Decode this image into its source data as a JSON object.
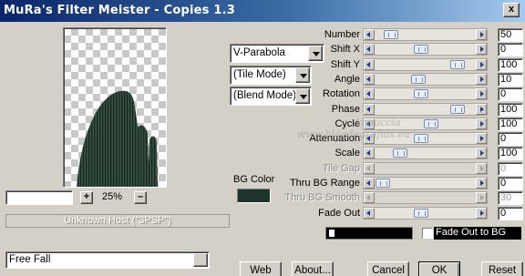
{
  "window": {
    "title": "MuRa's Filter Meister - Copies 1.3",
    "close_glyph": "x"
  },
  "preview": {
    "zoom_percent": "25%",
    "zoom_plus": "+",
    "zoom_minus": "–",
    "zoom_field_value": ""
  },
  "host_status": "Unknown Host (\"3PSP\")",
  "combos": {
    "shape": "V-Parabola",
    "tile_mode": "(Tile Mode)",
    "blend_mode": "(Blend Mode)"
  },
  "bg_color": {
    "label": "BG Color",
    "color": "#1e3329"
  },
  "params": [
    {
      "label": "Number",
      "value": "50",
      "pos": 0.1,
      "enabled": true
    },
    {
      "label": "Shift X",
      "value": "0",
      "pos": 0.45,
      "enabled": true
    },
    {
      "label": "Shift Y",
      "value": "100",
      "pos": 0.88,
      "enabled": true
    },
    {
      "label": "Angle",
      "value": "10",
      "pos": 0.42,
      "enabled": true
    },
    {
      "label": "Rotation",
      "value": "0",
      "pos": 0.45,
      "enabled": true
    },
    {
      "label": "Phase",
      "value": "100",
      "pos": 0.88,
      "enabled": true
    },
    {
      "label": "Cycle",
      "value": "100",
      "pos": 0.57,
      "enabled": true
    },
    {
      "label": "Attenuation",
      "value": "0",
      "pos": 0.45,
      "enabled": true
    },
    {
      "label": "Scale",
      "value": "100",
      "pos": 0.2,
      "enabled": true
    },
    {
      "label": "Tile Gap",
      "value": "0",
      "pos": 0.0,
      "enabled": false
    },
    {
      "label": "Thru BG Range",
      "value": "0",
      "pos": 0.0,
      "enabled": true
    },
    {
      "label": "Thru BG Smooth",
      "value": "30",
      "pos": 0.0,
      "enabled": false
    },
    {
      "label": "Fade Out",
      "value": "0",
      "pos": 0.45,
      "enabled": true
    }
  ],
  "fade_out_to_bg": {
    "label": "Fade Out to BG",
    "checked": false
  },
  "watermark": [
    "Annuccia",
    "www.blogdegrafias.eu"
  ],
  "preset": {
    "value": "Free Fall"
  },
  "buttons": {
    "web": "Web",
    "about": "About...",
    "cancel": "Cancel",
    "ok": "OK",
    "reset": "Reset"
  }
}
